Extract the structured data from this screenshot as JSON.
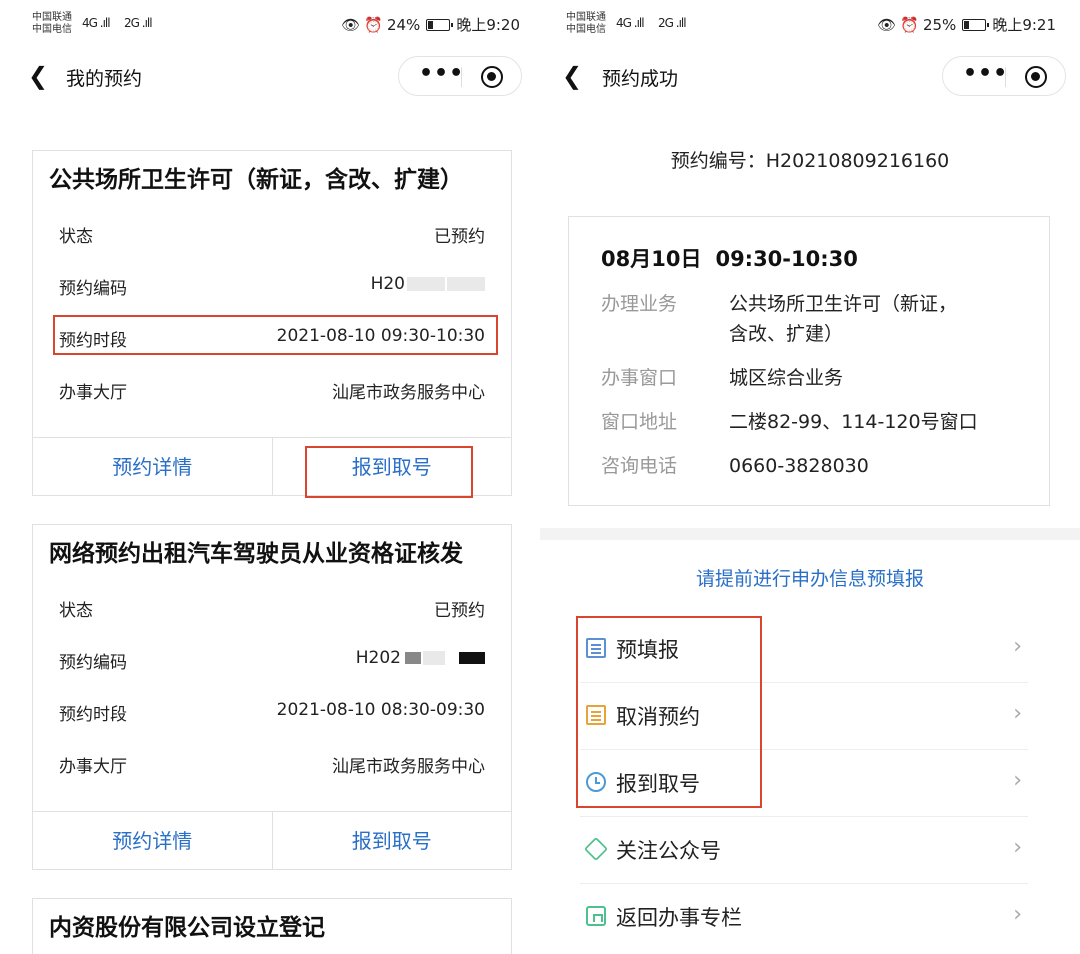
{
  "left": {
    "status": {
      "carrier_1": "中国联通",
      "carrier_2": "中国电信",
      "sig_1": "4G .ıll",
      "sig_2": "2G .ıll",
      "alarm_icon": "alarm-icon",
      "battery": "24%",
      "time": "晚上9:20"
    },
    "nav": {
      "title": "我的预约",
      "back_icon": "chevron-left-icon",
      "more_icon": "more-icon",
      "close_icon": "target-icon"
    },
    "cards": [
      {
        "title": "公共场所卫生许可（新证，含改、扩建）",
        "rows": [
          {
            "k": "状态",
            "v": "已预约"
          },
          {
            "k": "预约编码",
            "v": "H20"
          },
          {
            "k": "预约时段",
            "v": "2021-08-10 09:30-10:30"
          },
          {
            "k": "办事大厅",
            "v": "汕尾市政务服务中心"
          }
        ],
        "actions": [
          "预约详情",
          "报到取号"
        ]
      },
      {
        "title": "网络预约出租汽车驾驶员从业资格证核发",
        "rows": [
          {
            "k": "状态",
            "v": "已预约"
          },
          {
            "k": "预约编码",
            "v": "H202"
          },
          {
            "k": "预约时段",
            "v": "2021-08-10 08:30-09:30"
          },
          {
            "k": "办事大厅",
            "v": "汕尾市政务服务中心"
          }
        ],
        "actions": [
          "预约详情",
          "报到取号"
        ]
      },
      {
        "title": "内资股份有限公司设立登记"
      }
    ]
  },
  "right": {
    "status": {
      "carrier_1": "中国联通",
      "carrier_2": "中国电信",
      "sig_1": "4G .ıll",
      "sig_2": "2G .ıll",
      "battery": "25%",
      "time": "晚上9:21"
    },
    "nav": {
      "title": "预约成功"
    },
    "booking_no": "预约编号：H20210809216160",
    "date": "08月10日",
    "time_range": "09:30-10:30",
    "info": [
      {
        "k": "办理业务",
        "v": "公共场所卫生许可（新证，",
        "v2": "含改、扩建）"
      },
      {
        "k": "办事窗口",
        "v": "城区综合业务"
      },
      {
        "k": "窗口地址",
        "v": "二楼82-99、114-120号窗口"
      },
      {
        "k": "咨询电话",
        "v": "0660-3828030"
      }
    ],
    "prefill_tip": "请提前进行申办信息预填报",
    "menu": [
      {
        "label": "预填报",
        "icon": "form-icon"
      },
      {
        "label": "取消预约",
        "icon": "cancel-booking-icon"
      },
      {
        "label": "报到取号",
        "icon": "clock-icon"
      },
      {
        "label": "关注公众号",
        "icon": "badge-icon"
      },
      {
        "label": "返回办事专栏",
        "icon": "home-icon"
      }
    ],
    "chevron": "›"
  },
  "colors": {
    "link": "#2a6fc7",
    "highlight": "#d9452f",
    "muted": "#999999"
  }
}
